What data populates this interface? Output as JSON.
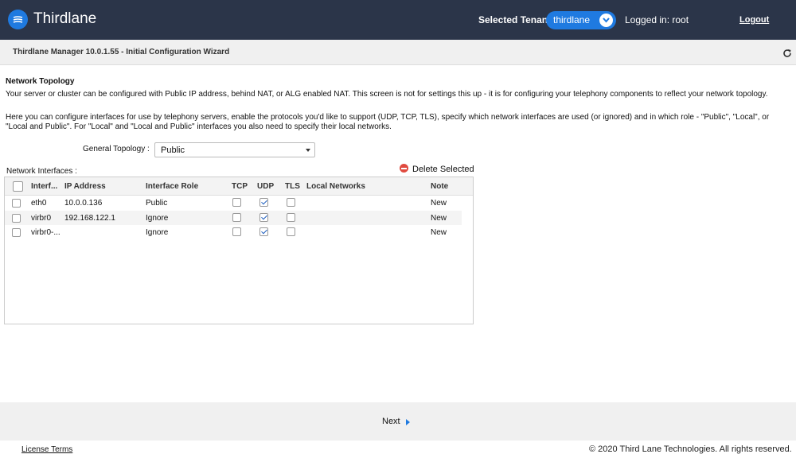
{
  "header": {
    "brand": "Thirdlane",
    "tenant_label": "Selected Tenant :",
    "tenant_value": "thirdlane",
    "logged_in": "Logged in: root",
    "logout": "Logout"
  },
  "titlebar": {
    "title": "Thirdlane Manager 10.0.1.55 - Initial Configuration Wizard"
  },
  "section": {
    "title": "Network Topology",
    "para1": "Your server or cluster can be configured with Public IP address, behind NAT, or ALG enabled NAT. This screen is not for settings this up - it is for configuring your telephony components to reflect your network topology.",
    "para2": "Here you can configure interfaces for use by telephony servers, enable the protocols you'd like to support (UDP, TCP, TLS), specify which network interfaces are used (or ignored) and in which role - \"Public\", \"Local\", or \"Local and Public\". For \"Local\" and \"Local and Public\" interfaces you also need to specify their local networks."
  },
  "form": {
    "topology_label": "General Topology :",
    "topology_value": "Public",
    "interfaces_label": "Network Interfaces :",
    "delete_selected": "Delete Selected"
  },
  "table": {
    "headers": {
      "iface": "Interf...",
      "ip": "IP Address",
      "role": "Interface Role",
      "tcp": "TCP",
      "udp": "UDP",
      "tls": "TLS",
      "networks": "Local Networks",
      "note": "Note"
    },
    "rows": [
      {
        "iface": "eth0",
        "ip": "10.0.0.136",
        "role": "Public",
        "tcp": false,
        "udp": true,
        "tls": false,
        "networks": "",
        "note": "New"
      },
      {
        "iface": "virbr0",
        "ip": "192.168.122.1",
        "role": "Ignore",
        "tcp": false,
        "udp": true,
        "tls": false,
        "networks": "",
        "note": "New"
      },
      {
        "iface": "virbr0-...",
        "ip": "",
        "role": "Ignore",
        "tcp": false,
        "udp": true,
        "tls": false,
        "networks": "",
        "note": "New"
      }
    ]
  },
  "footer": {
    "next": "Next",
    "license": "License Terms",
    "copyright": "© 2020 Third Lane Technologies. All rights reserved."
  },
  "colors": {
    "header_bg": "#2b3549",
    "accent": "#1f7ae0",
    "danger": "#e04a3f"
  }
}
